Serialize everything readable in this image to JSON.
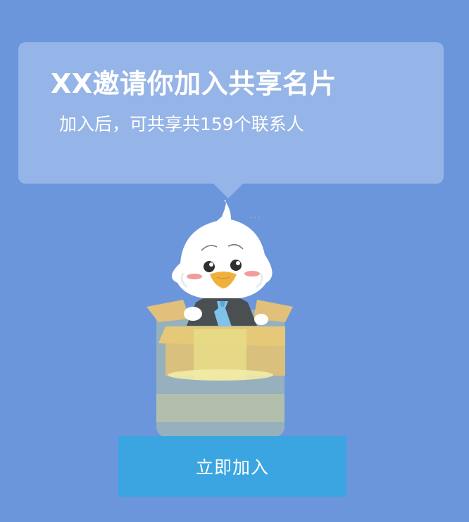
{
  "invite": {
    "title": "XX邀请你加入共享名片",
    "subtitle": "加入后，可共享共159个联系人"
  },
  "actions": {
    "join_label": "立即加入"
  },
  "colors": {
    "background": "#6b96dc",
    "bubble": "#95b4e7",
    "button": "#3aa5e0"
  },
  "illustration": {
    "icon": "eagle-mascot-in-box-icon"
  }
}
